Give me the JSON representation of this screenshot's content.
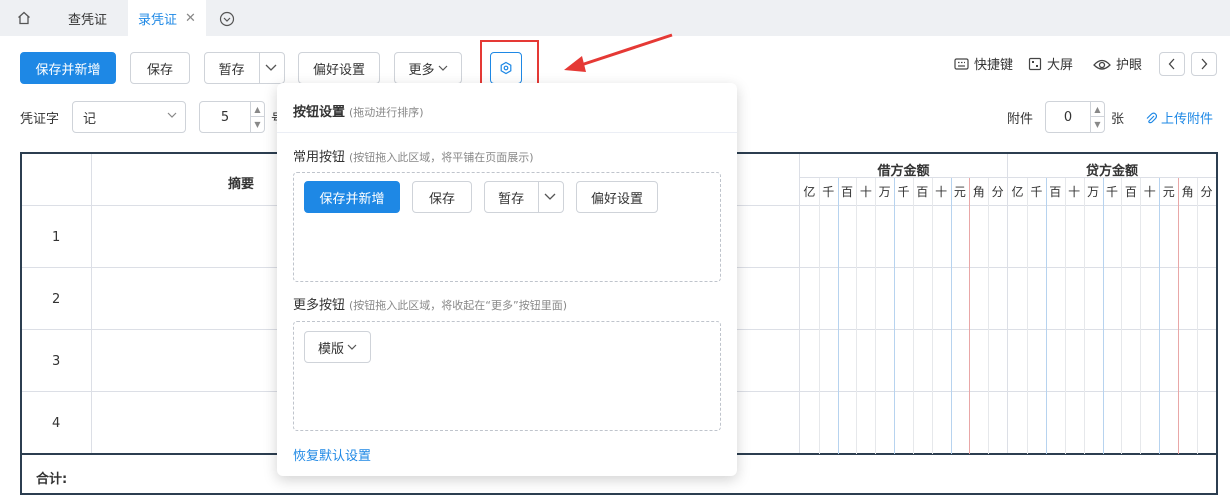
{
  "tabs": {
    "items": [
      {
        "label": "查凭证"
      },
      {
        "label": "录凭证"
      }
    ]
  },
  "toolbar": {
    "save_new": "保存并新增",
    "save": "保存",
    "temp_save": "暂存",
    "preferences": "偏好设置",
    "more": "更多",
    "shortcut": "快捷键",
    "fullscreen": "大屏",
    "eye_care": "护眼"
  },
  "header": {
    "voucher_word_label": "凭证字",
    "voucher_word_value": "记",
    "voucher_no": "5",
    "voucher_no_suffix": "号",
    "attach_label": "附件",
    "attach_count": "0",
    "attach_unit": "张",
    "upload": "上传附件"
  },
  "table": {
    "col_summary": "摘要",
    "debit": "借方金额",
    "credit": "贷方金额",
    "digits": [
      "亿",
      "千",
      "百",
      "十",
      "万",
      "千",
      "百",
      "十",
      "元",
      "角",
      "分"
    ],
    "rows": [
      "1",
      "2",
      "3",
      "4"
    ],
    "total": "合计:"
  },
  "popover": {
    "title": "按钮设置",
    "title_hint": "(拖动进行排序)",
    "common_title": "常用按钮",
    "common_hint": "(按钮拖入此区域，将平铺在页面展示)",
    "more_title": "更多按钮",
    "more_hint": "(按钮拖入此区域，将收起在“更多”按钮里面)",
    "common_buttons": {
      "save_new": "保存并新增",
      "save": "保存",
      "temp_save": "暂存",
      "preferences": "偏好设置"
    },
    "more_buttons": {
      "template": "模版"
    },
    "restore": "恢复默认设置"
  },
  "colors": {
    "accent": "#1e88e5",
    "highlight": "#e53935",
    "table_border": "#2c3e50"
  }
}
